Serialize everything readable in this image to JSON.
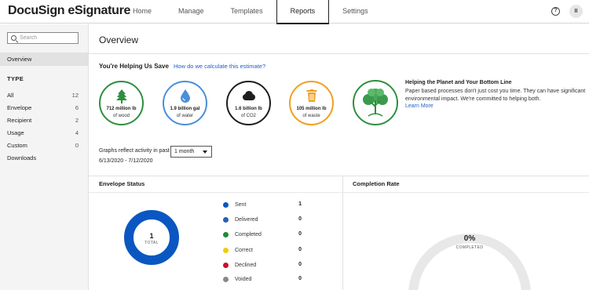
{
  "app": {
    "logo": "DocuSign eSignature"
  },
  "nav": {
    "tabs": [
      {
        "label": "Home"
      },
      {
        "label": "Manage"
      },
      {
        "label": "Templates"
      },
      {
        "label": "Reports"
      },
      {
        "label": "Settings"
      }
    ],
    "active": "Reports"
  },
  "header": {
    "help_icon": "question-circle-icon",
    "avatar_initials": "II"
  },
  "sidebar": {
    "search_placeholder": "Search",
    "overview": "Overview",
    "type_heading": "TYPE",
    "items": [
      {
        "label": "All",
        "count": "12"
      },
      {
        "label": "Envelope",
        "count": "6"
      },
      {
        "label": "Recipient",
        "count": "2"
      },
      {
        "label": "Usage",
        "count": "4"
      },
      {
        "label": "Custom",
        "count": "0"
      },
      {
        "label": "Downloads",
        "count": ""
      }
    ]
  },
  "main": {
    "title": "Overview",
    "saving_heading": "You're Helping Us Save",
    "saving_link": "How do we calculate this estimate?",
    "savings": [
      {
        "value": "712 million lb",
        "unit": "of wood",
        "icon": "tree-icon",
        "color": "#2e8f3e"
      },
      {
        "value": "1.9 billion gal",
        "unit": "of water",
        "icon": "water-drop-icon",
        "color": "#4a8fd8"
      },
      {
        "value": "1.6 billion lb",
        "unit": "of CO2",
        "icon": "cloud-icon",
        "color": "#1e1e1e"
      },
      {
        "value": "105 million lb",
        "unit": "of waste",
        "icon": "trash-icon",
        "color": "#f0a020"
      }
    ],
    "planet": {
      "title": "Helping the Planet and Your Bottom Line",
      "text": "Paper based processes don't just cost you time. They can have significant environmental impact. We're committed to helping both.",
      "link": "Learn More"
    },
    "graphs_label": "Graphs reflect activity in past",
    "graphs_select": "1 month",
    "date_range": "6/13/2020 - 7/12/2020"
  },
  "envelope_status": {
    "heading": "Envelope Status",
    "total": "1",
    "total_label": "TOTAL",
    "legend": [
      {
        "label": "Sent",
        "value": "1",
        "color": "#0a57c1"
      },
      {
        "label": "Delivered",
        "value": "0",
        "color": "#2a5fb8"
      },
      {
        "label": "Completed",
        "value": "0",
        "color": "#1f8a3a"
      },
      {
        "label": "Correct",
        "value": "0",
        "color": "#f2cc0c"
      },
      {
        "label": "Declined",
        "value": "0",
        "color": "#c8102e"
      },
      {
        "label": "Voided",
        "value": "0",
        "color": "#888888"
      }
    ]
  },
  "completion_rate": {
    "heading": "Completion Rate",
    "percent": "0%",
    "label": "COMPLETED"
  }
}
